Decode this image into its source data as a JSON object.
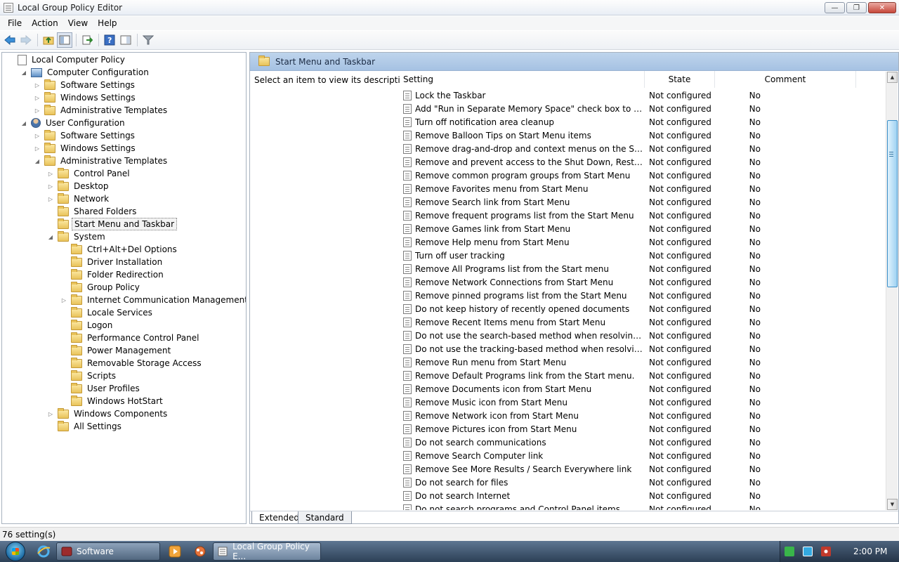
{
  "window": {
    "title": "Local Group Policy Editor",
    "minimize": "—",
    "restore": "❐",
    "close": "✕"
  },
  "menu": [
    "File",
    "Action",
    "View",
    "Help"
  ],
  "tree": [
    {
      "label": "Local Computer Policy",
      "level": 0,
      "icon": "policy-doc-icon",
      "expander": ""
    },
    {
      "label": "Computer Configuration",
      "level": 1,
      "icon": "computer-icon",
      "expander": "◢"
    },
    {
      "label": "Software Settings",
      "level": 2,
      "icon": "folder-icon",
      "expander": "▷"
    },
    {
      "label": "Windows Settings",
      "level": 2,
      "icon": "folder-icon",
      "expander": "▷"
    },
    {
      "label": "Administrative Templates",
      "level": 2,
      "icon": "folder-icon",
      "expander": "▷"
    },
    {
      "label": "User Configuration",
      "level": 1,
      "icon": "user-icon",
      "expander": "◢"
    },
    {
      "label": "Software Settings",
      "level": 2,
      "icon": "folder-icon",
      "expander": "▷"
    },
    {
      "label": "Windows Settings",
      "level": 2,
      "icon": "folder-icon",
      "expander": "▷"
    },
    {
      "label": "Administrative Templates",
      "level": 2,
      "icon": "folder-icon",
      "expander": "◢"
    },
    {
      "label": "Control Panel",
      "level": 3,
      "icon": "folder-icon",
      "expander": "▷"
    },
    {
      "label": "Desktop",
      "level": 3,
      "icon": "folder-icon",
      "expander": "▷"
    },
    {
      "label": "Network",
      "level": 3,
      "icon": "folder-icon",
      "expander": "▷"
    },
    {
      "label": "Shared Folders",
      "level": 3,
      "icon": "folder-icon",
      "expander": ""
    },
    {
      "label": "Start Menu and Taskbar",
      "level": 3,
      "icon": "folder-icon",
      "expander": "",
      "selected": true
    },
    {
      "label": "System",
      "level": 3,
      "icon": "folder-icon",
      "expander": "◢"
    },
    {
      "label": "Ctrl+Alt+Del Options",
      "level": 4,
      "icon": "folder-icon",
      "expander": ""
    },
    {
      "label": "Driver Installation",
      "level": 4,
      "icon": "folder-icon",
      "expander": ""
    },
    {
      "label": "Folder Redirection",
      "level": 4,
      "icon": "folder-icon",
      "expander": ""
    },
    {
      "label": "Group Policy",
      "level": 4,
      "icon": "folder-icon",
      "expander": ""
    },
    {
      "label": "Internet Communication Management",
      "level": 4,
      "icon": "folder-icon",
      "expander": "▷"
    },
    {
      "label": "Locale Services",
      "level": 4,
      "icon": "folder-icon",
      "expander": ""
    },
    {
      "label": "Logon",
      "level": 4,
      "icon": "folder-icon",
      "expander": ""
    },
    {
      "label": "Performance Control Panel",
      "level": 4,
      "icon": "folder-icon",
      "expander": ""
    },
    {
      "label": "Power Management",
      "level": 4,
      "icon": "folder-icon",
      "expander": ""
    },
    {
      "label": "Removable Storage Access",
      "level": 4,
      "icon": "folder-icon",
      "expander": ""
    },
    {
      "label": "Scripts",
      "level": 4,
      "icon": "folder-icon",
      "expander": ""
    },
    {
      "label": "User Profiles",
      "level": 4,
      "icon": "folder-icon",
      "expander": ""
    },
    {
      "label": "Windows HotStart",
      "level": 4,
      "icon": "folder-icon",
      "expander": ""
    },
    {
      "label": "Windows Components",
      "level": 3,
      "icon": "folder-icon",
      "expander": "▷"
    },
    {
      "label": "All Settings",
      "level": 3,
      "icon": "all-settings-icon",
      "expander": ""
    }
  ],
  "right": {
    "header_title": "Start Menu and Taskbar",
    "description": "Select an item to view its description.",
    "columns": {
      "setting": "Setting",
      "state": "State",
      "comment": "Comment"
    },
    "rows": [
      {
        "name": "Lock the Taskbar",
        "state": "Not configured",
        "comment": "No"
      },
      {
        "name": "Add \"Run in Separate Memory Space\" check box to Run dial...",
        "state": "Not configured",
        "comment": "No"
      },
      {
        "name": "Turn off notification area cleanup",
        "state": "Not configured",
        "comment": "No"
      },
      {
        "name": "Remove Balloon Tips on Start Menu items",
        "state": "Not configured",
        "comment": "No"
      },
      {
        "name": "Remove drag-and-drop and context menus on the Start Me...",
        "state": "Not configured",
        "comment": "No"
      },
      {
        "name": "Remove and prevent access to the Shut Down, Restart, Sleep...",
        "state": "Not configured",
        "comment": "No"
      },
      {
        "name": "Remove common program groups from Start Menu",
        "state": "Not configured",
        "comment": "No"
      },
      {
        "name": "Remove Favorites menu from Start Menu",
        "state": "Not configured",
        "comment": "No"
      },
      {
        "name": "Remove Search link from Start Menu",
        "state": "Not configured",
        "comment": "No"
      },
      {
        "name": "Remove frequent programs list from the Start Menu",
        "state": "Not configured",
        "comment": "No"
      },
      {
        "name": "Remove Games link from Start Menu",
        "state": "Not configured",
        "comment": "No"
      },
      {
        "name": "Remove Help menu from Start Menu",
        "state": "Not configured",
        "comment": "No"
      },
      {
        "name": "Turn off user tracking",
        "state": "Not configured",
        "comment": "No"
      },
      {
        "name": "Remove All Programs list from the Start menu",
        "state": "Not configured",
        "comment": "No"
      },
      {
        "name": "Remove Network Connections from Start Menu",
        "state": "Not configured",
        "comment": "No"
      },
      {
        "name": "Remove pinned programs list from the Start Menu",
        "state": "Not configured",
        "comment": "No"
      },
      {
        "name": "Do not keep history of recently opened documents",
        "state": "Not configured",
        "comment": "No"
      },
      {
        "name": "Remove Recent Items menu from Start Menu",
        "state": "Not configured",
        "comment": "No"
      },
      {
        "name": "Do not use the search-based method when resolving shell s...",
        "state": "Not configured",
        "comment": "No"
      },
      {
        "name": "Do not use the tracking-based method when resolving shell ...",
        "state": "Not configured",
        "comment": "No"
      },
      {
        "name": "Remove Run menu from Start Menu",
        "state": "Not configured",
        "comment": "No"
      },
      {
        "name": "Remove Default Programs link from the Start menu.",
        "state": "Not configured",
        "comment": "No"
      },
      {
        "name": "Remove Documents icon from Start Menu",
        "state": "Not configured",
        "comment": "No"
      },
      {
        "name": "Remove Music icon from Start Menu",
        "state": "Not configured",
        "comment": "No"
      },
      {
        "name": "Remove Network icon from Start Menu",
        "state": "Not configured",
        "comment": "No"
      },
      {
        "name": "Remove Pictures icon from Start Menu",
        "state": "Not configured",
        "comment": "No"
      },
      {
        "name": "Do not search communications",
        "state": "Not configured",
        "comment": "No"
      },
      {
        "name": "Remove Search Computer link",
        "state": "Not configured",
        "comment": "No"
      },
      {
        "name": "Remove See More Results / Search Everywhere link",
        "state": "Not configured",
        "comment": "No"
      },
      {
        "name": "Do not search for files",
        "state": "Not configured",
        "comment": "No"
      },
      {
        "name": "Do not search Internet",
        "state": "Not configured",
        "comment": "No"
      },
      {
        "name": "Do not search programs and Control Panel items",
        "state": "Not configured",
        "comment": "No"
      }
    ],
    "tabs": {
      "extended": "Extended",
      "standard": "Standard"
    }
  },
  "status": {
    "text": "76 setting(s)"
  },
  "taskbar": {
    "task_software": "Software",
    "task_gpedit": "Local Group Policy E...",
    "clock": "2:00 PM"
  },
  "colors": {
    "accent": "#a6c2e3",
    "taskbar": "#2c4056"
  }
}
